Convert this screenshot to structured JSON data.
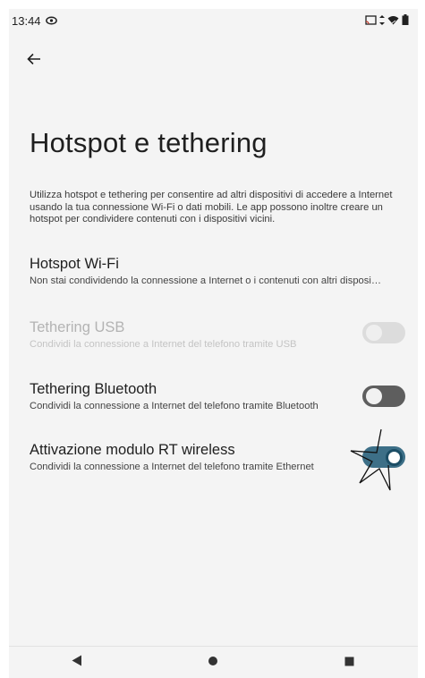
{
  "status_bar": {
    "time": "13:44",
    "icons": [
      "eye-icon",
      "cast-icon",
      "data-arrows-icon",
      "wifi-icon",
      "battery-icon"
    ]
  },
  "header": {
    "back_icon": "arrow-left-icon",
    "title": "Hotspot e tethering"
  },
  "intro": "Utilizza hotspot e tethering per consentire ad altri dispositivi di accedere a Internet usando la tua connessione Wi-Fi o dati mobili. Le app possono inoltre creare un hotspot per condividere contenuti con i dispositivi vicini.",
  "settings": [
    {
      "title": "Hotspot Wi-Fi",
      "summary": "Non stai condividendo la connessione a Internet o i contenuti con altri disposi…"
    },
    {
      "title": "Tethering USB",
      "summary": "Condividi la connessione a Internet del telefono tramite USB",
      "enabled": false,
      "checked": false
    },
    {
      "title": "Tethering Bluetooth",
      "summary": "Condividi la connessione a Internet del telefono tramite Bluetooth",
      "enabled": true,
      "checked": false
    },
    {
      "title": "Attivazione modulo RT wireless",
      "summary": "Condividi la connessione a Internet del telefono tramite Ethernet",
      "enabled": true,
      "checked": true
    }
  ],
  "nav_bar": {
    "icons": [
      "nav-back-icon",
      "nav-home-icon",
      "nav-recents-icon"
    ]
  },
  "colors": {
    "background": "#f4f4f4",
    "toggle_on": "#3d6f87",
    "toggle_off": "#5e5e5e",
    "toggle_disabled": "#dcdcdc"
  }
}
